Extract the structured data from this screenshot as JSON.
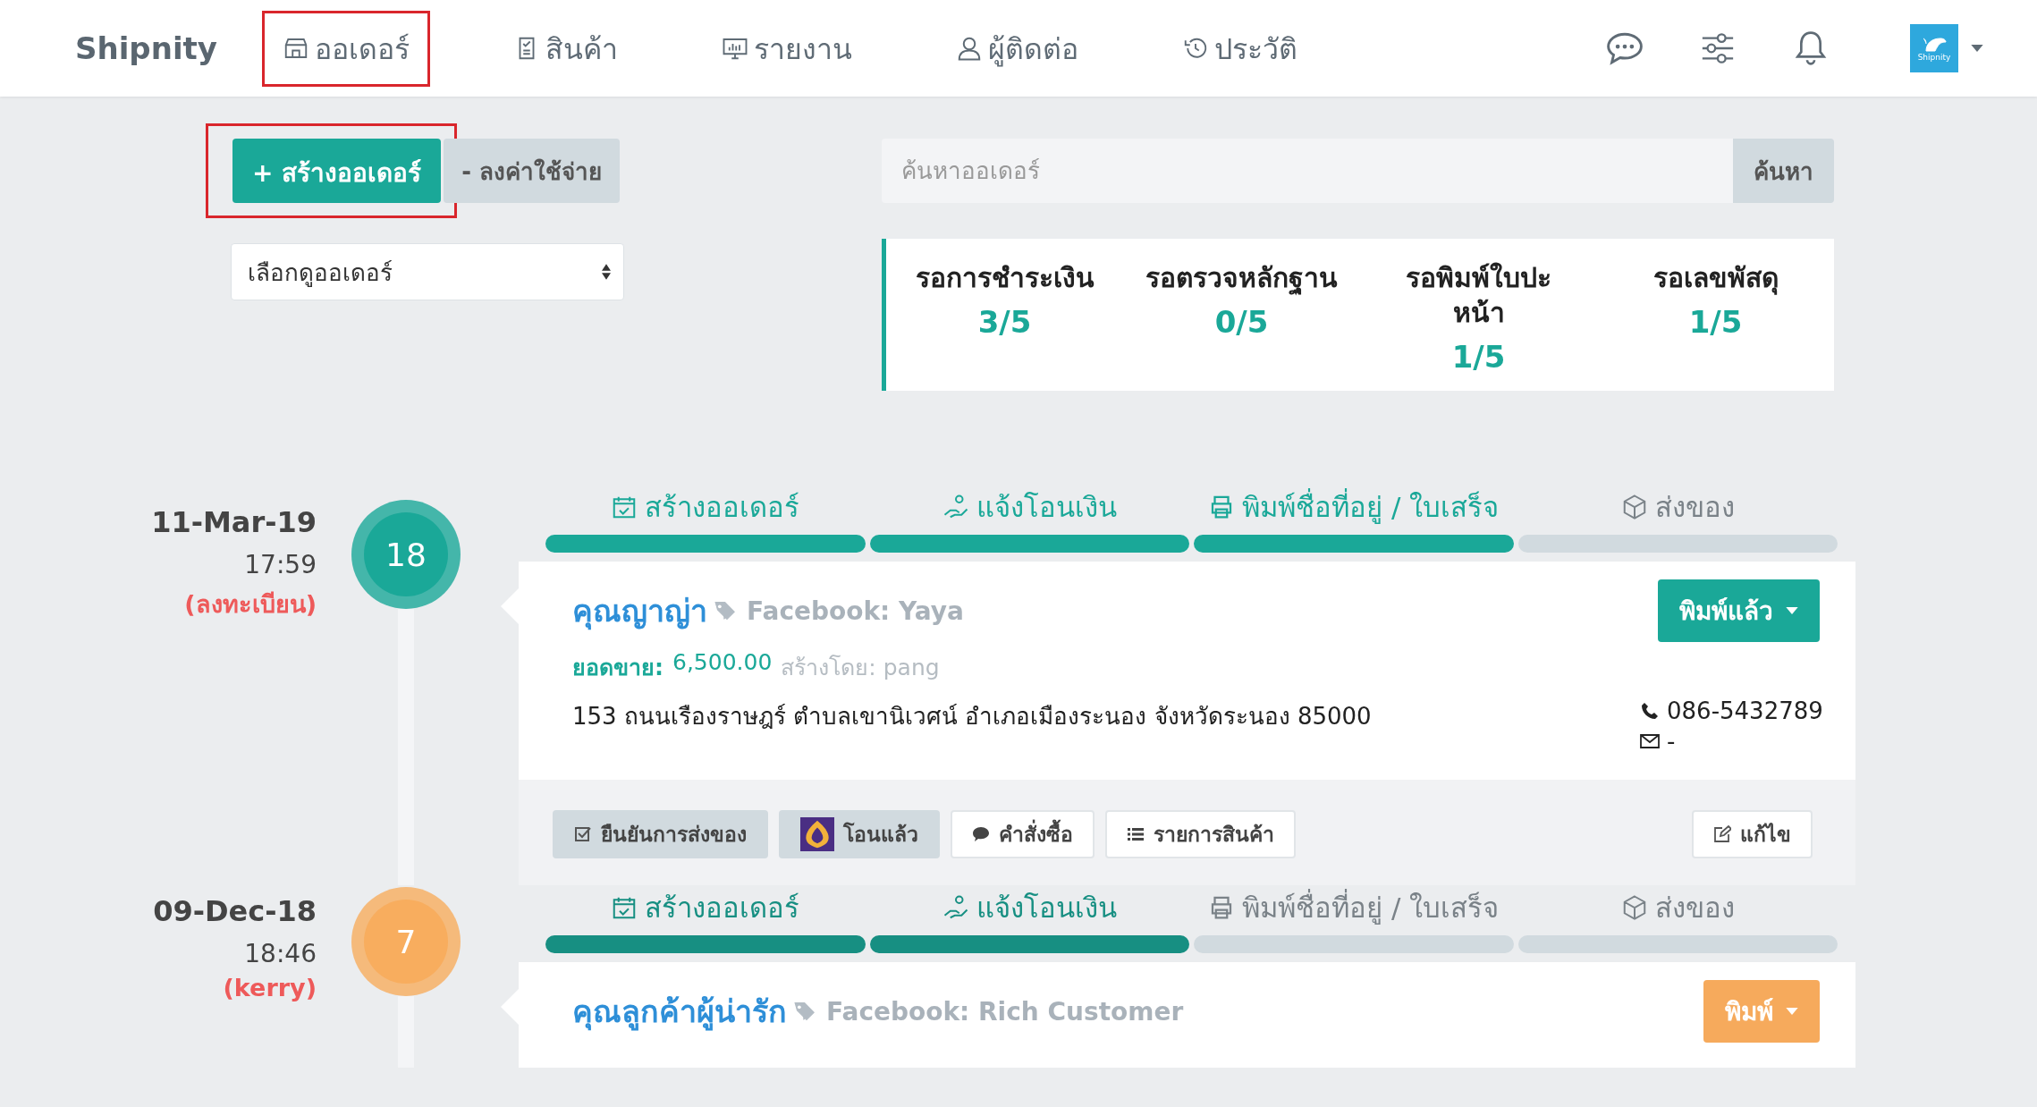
{
  "brand": "Shipnity",
  "nav": [
    {
      "label": "ออเดอร์",
      "kind": "store",
      "highlighted": true
    },
    {
      "label": "สินค้า",
      "kind": "clipboard",
      "highlighted": false
    },
    {
      "label": "รายงาน",
      "kind": "chart",
      "highlighted": false
    },
    {
      "label": "ผู้ติดต่อ",
      "kind": "user",
      "highlighted": false
    },
    {
      "label": "ประวัติ",
      "kind": "history",
      "highlighted": false
    }
  ],
  "avatar_label": "Shipnity",
  "create_button": {
    "label": "+ สร้างออเดอร์",
    "highlighted": true
  },
  "expense_button": "- ลงค่าใช้จ่าย",
  "order_select": "เลือกดูออเดอร์",
  "search": {
    "placeholder": "ค้นหาออเดอร์",
    "button": "ค้นหา"
  },
  "stats": [
    {
      "label": "รอการชำระเงิน",
      "value": "3/5"
    },
    {
      "label": "รอตรวจหลักฐาน",
      "value": "0/5"
    },
    {
      "label": "รอพิมพ์ใบปะหน้า",
      "value": "1/5"
    },
    {
      "label": "รอเลขพัสดุ",
      "value": "1/5"
    }
  ],
  "orders": [
    {
      "date": "11-Mar-19",
      "time": "17:59",
      "carrier": "(ลงทะเบียน)",
      "count": "18",
      "color": "#1aa898",
      "steps": [
        {
          "label": "สร้างออเดอร์",
          "kind": "calendar",
          "done": true
        },
        {
          "label": "แจ้งโอนเงิน",
          "kind": "hand",
          "done": true
        },
        {
          "label": "พิมพ์ชื่อที่อยู่ / ใบเสร็จ",
          "kind": "printer",
          "done": true
        },
        {
          "label": "ส่งของ",
          "kind": "box",
          "done": false
        }
      ],
      "customer": "คุณญาญ่า",
      "channel": "Facebook: Yaya",
      "sales_label": "ยอดขาย:",
      "amount": "6,500.00",
      "created_by": "สร้างโดย: pang",
      "address": "153 ถนนเรืองราษฎร์ ตำบลเขานิเวศน์ อำเภอเมืองระนอง จังหวัดระนอง 85000",
      "phone": "086-5432789",
      "email": "-",
      "status": {
        "label": "พิมพ์แล้ว",
        "color": "#1aa898"
      },
      "actions": [
        {
          "kind": "confirm",
          "label": "ยืนยันการส่งของ"
        },
        {
          "kind": "paid",
          "label": "โอนแล้ว"
        },
        {
          "kind": "note",
          "label": "คำสั่งซื้อ"
        },
        {
          "kind": "items",
          "label": "รายการสินค้า"
        }
      ],
      "edit": "แก้ไข"
    },
    {
      "date": "09-Dec-18",
      "time": "18:46",
      "carrier": "(kerry)",
      "count": "7",
      "color": "#f8ad5e",
      "steps": [
        {
          "label": "สร้างออเดอร์",
          "kind": "calendar",
          "done": true
        },
        {
          "label": "แจ้งโอนเงิน",
          "kind": "hand",
          "done": true
        },
        {
          "label": "พิมพ์ชื่อที่อยู่ / ใบเสร็จ",
          "kind": "printer",
          "done": false
        },
        {
          "label": "ส่งของ",
          "kind": "box",
          "done": false
        }
      ],
      "customer": "คุณลูกค้าผู้น่ารัก",
      "channel": "Facebook: Rich Customer",
      "status": {
        "label": "พิมพ์",
        "color": "#f6aa5c"
      }
    }
  ]
}
